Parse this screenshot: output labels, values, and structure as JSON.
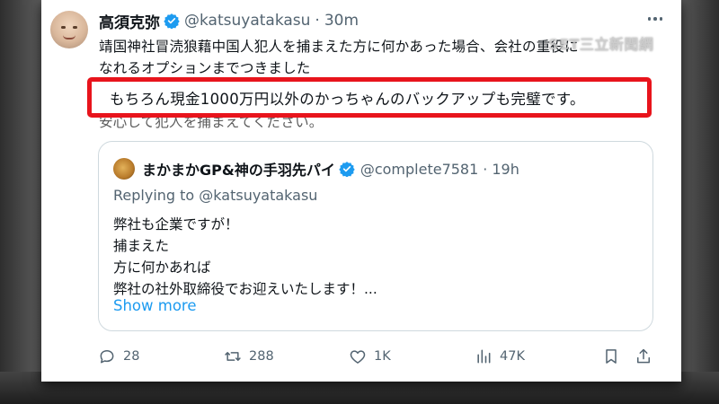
{
  "tweet": {
    "display_name": "高須克弥",
    "handle": "@katsuyatakasu",
    "separator": "·",
    "time": "30m",
    "lines": [
      "靖国神社冒涜狼藉中国人犯人を捕まえた方に何かあった場合、会社の重役に",
      "なれるオプションまでつきました",
      "もちろん現金1000万円以外のかっちゃんのバックアップも完璧です。",
      "安心して犯人を捕まえてください。"
    ]
  },
  "quoted": {
    "display_name": "まかまかGP&神の手羽先パイ",
    "handle": "@complete7581",
    "separator": "·",
    "time": "19h",
    "replying_to": "Replying to @katsuyatakasu",
    "body_lines": [
      "弊社も企業ですが！",
      "捕まえた",
      "方に何かあれば",
      "弊社の社外取締役でお迎えいたします！..."
    ],
    "show_more": "Show more"
  },
  "actions": {
    "replies": "28",
    "reposts": "288",
    "likes": "1K",
    "views": "47K"
  },
  "icons": {
    "verified": "verified-badge-icon",
    "more": "more-icon",
    "reply": "reply-icon",
    "repost": "repost-icon",
    "like": "heart-icon",
    "views": "views-icon",
    "bookmark": "bookmark-icon",
    "share": "share-icon"
  },
  "watermark": "SET三立新聞網",
  "colors": {
    "highlight_border": "#e8141c",
    "verified_blue": "#1d9bf0",
    "link_blue": "#1d9bf0",
    "muted_text": "#536471"
  }
}
